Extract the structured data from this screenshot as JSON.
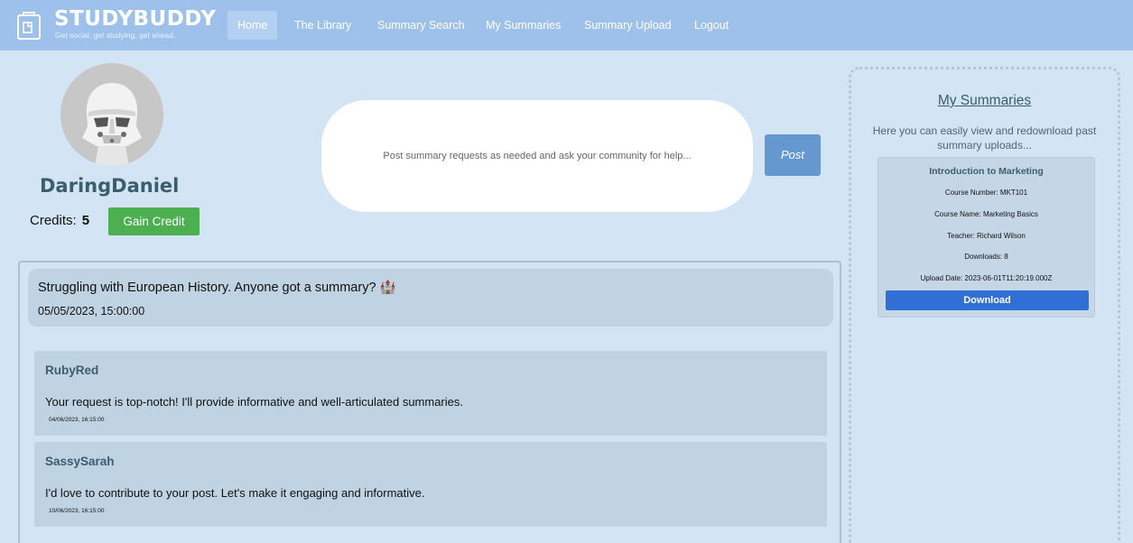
{
  "brand": {
    "name": "STUDYBUDDY",
    "tagline": "Get social, get studying, get ahead."
  },
  "nav": {
    "items": [
      {
        "label": "Home",
        "active": true
      },
      {
        "label": "The Library"
      },
      {
        "label": "Summary Search"
      },
      {
        "label": "My Summaries"
      },
      {
        "label": "Summary Upload"
      },
      {
        "label": "Logout"
      }
    ]
  },
  "profile": {
    "avatar": "stormtrooper-avatar",
    "username": "DaringDaniel",
    "credits_label": "Credits:",
    "credits_value": "5",
    "gain_credit_label": "Gain Credit"
  },
  "compose": {
    "placeholder": "Post summary requests as needed and ask your community for help...",
    "post_label": "Post"
  },
  "feed": {
    "post": {
      "title": "Struggling with European History. Anyone got a summary? 🏰",
      "date": "05/05/2023, 15:00:00"
    },
    "comments": [
      {
        "author": "RubyRed",
        "text": "Your request is top-notch! I'll provide informative and well-articulated summaries.",
        "date": "04/06/2023, 16:15:00"
      },
      {
        "author": "SassySarah",
        "text": "I'd love to contribute to your post. Let's make it engaging and informative.",
        "date": "10/06/2023, 16:15:00"
      }
    ]
  },
  "sidebar": {
    "title": "My Summaries",
    "description": "Here you can easily view and redownload past summary uploads...",
    "card": {
      "title": "Introduction to Marketing",
      "course_number": "Course Number: MKT101",
      "course_name": "Course Name: Marketing Basics",
      "teacher": "Teacher: Richard Wilson",
      "downloads": "Downloads: 8",
      "upload_date": "Upload Date: 2023-06-01T11:20:19.000Z",
      "download_label": "Download"
    }
  },
  "colors": {
    "nav_bg": "#9ec1ec",
    "page_bg": "#d3e4f4",
    "accent_green": "#4caf50",
    "accent_blue": "#2f6fd6",
    "heading_teal": "#3a5e6e"
  }
}
